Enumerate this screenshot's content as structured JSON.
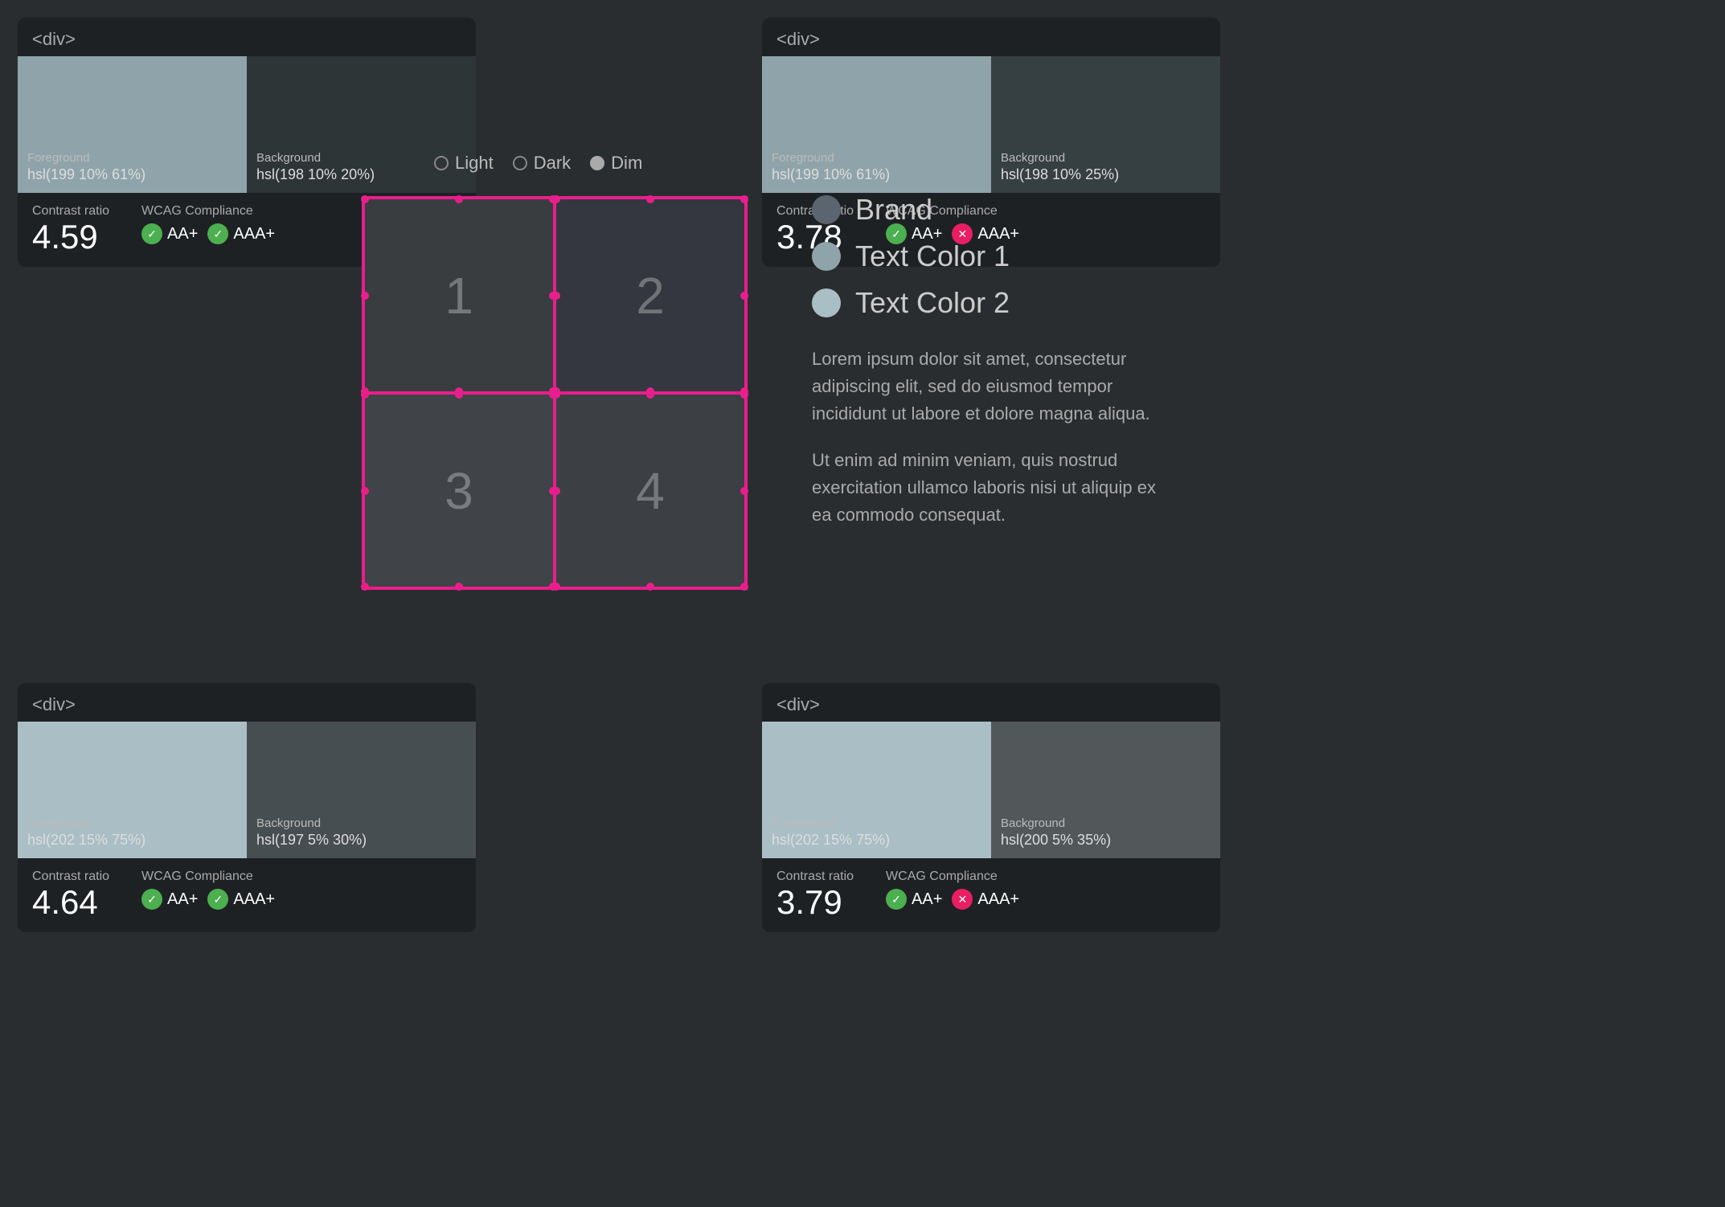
{
  "panels": {
    "top_left": {
      "tag": "<div>",
      "fg_label": "Foreground",
      "fg_value": "hsl(199 10% 61%)",
      "fg_color": "#8fa4aa",
      "bg_label": "Background",
      "bg_value": "hsl(198 10% 20%)",
      "bg_color": "#2d3537",
      "contrast_label": "Contrast ratio",
      "contrast_value": "4.59",
      "wcag_label": "WCAG Compliance",
      "badge_aa": "AA+",
      "badge_aaa": "AAA+",
      "aa_pass": true,
      "aaa_pass": true
    },
    "top_right": {
      "tag": "<div>",
      "fg_label": "Foreground",
      "fg_value": "hsl(199 10% 61%)",
      "fg_color": "#8fa4aa",
      "bg_label": "Background",
      "bg_value": "hsl(198 10% 25%)",
      "bg_color": "#363f42",
      "contrast_label": "Contrast ratio",
      "contrast_value": "3.78",
      "wcag_label": "WCAG Compliance",
      "badge_aa": "AA+",
      "badge_aaa": "AAA+",
      "aa_pass": true,
      "aaa_pass": false
    },
    "bottom_left": {
      "tag": "<div>",
      "fg_label": "Foreground",
      "fg_value": "hsl(202 15% 75%)",
      "fg_color": "#aabec5",
      "bg_label": "Background",
      "bg_value": "hsl(197 5% 30%)",
      "bg_color": "#474e51",
      "contrast_label": "Contrast ratio",
      "contrast_value": "4.64",
      "wcag_label": "WCAG Compliance",
      "badge_aa": "AA+",
      "badge_aaa": "AAA+",
      "aa_pass": true,
      "aaa_pass": true
    },
    "bottom_right": {
      "tag": "<div>",
      "fg_label": "Foreground",
      "fg_value": "hsl(202 15% 75%)",
      "fg_color": "#aabec5",
      "bg_label": "Background",
      "bg_value": "hsl(200 5% 35%)",
      "bg_color": "#525859",
      "contrast_label": "Contrast ratio",
      "contrast_value": "3.79",
      "wcag_label": "WCAG Compliance",
      "badge_aa": "AA+",
      "badge_aaa": "AAA+",
      "aa_pass": true,
      "aaa_pass": false
    }
  },
  "theme_selector": {
    "options": [
      "Light",
      "Dark",
      "Dim"
    ],
    "selected": "Dim"
  },
  "grid": {
    "cells": [
      "1",
      "2",
      "3",
      "4"
    ]
  },
  "legend": {
    "items": [
      {
        "label": "Brand",
        "color": "#5a6570"
      },
      {
        "label": "Text Color 1",
        "color": "#8fa4aa"
      },
      {
        "label": "Text Color 2",
        "color": "#aabec5"
      }
    ]
  },
  "lorem": {
    "p1": "Lorem ipsum dolor sit amet, consectetur adipiscing elit, sed do eiusmod tempor incididunt ut labore et dolore magna aliqua.",
    "p2": "Ut enim ad minim veniam, quis nostrud exercitation ullamco laboris nisi ut aliquip ex ea commodo consequat."
  }
}
